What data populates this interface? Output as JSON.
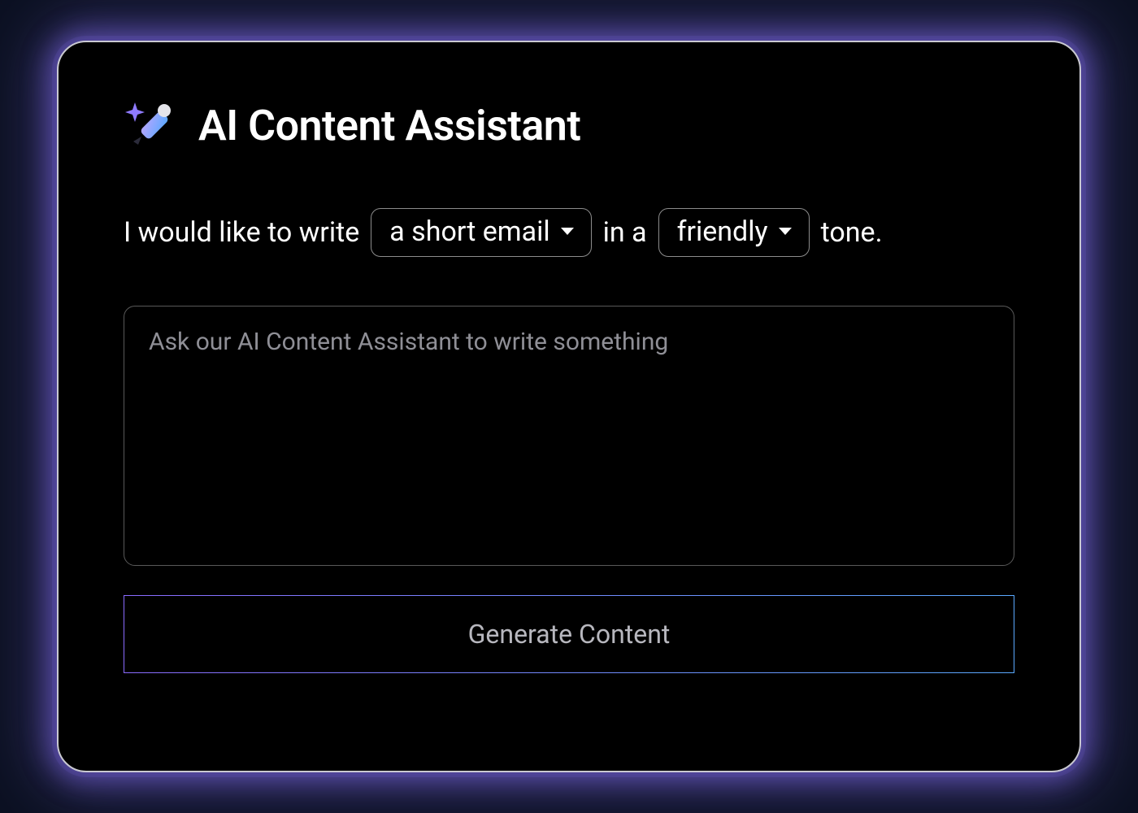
{
  "header": {
    "title": "AI Content Assistant",
    "icon": "magic-pencil-icon"
  },
  "sentence": {
    "prefix": "I would like to write",
    "type_select": {
      "value": "a short email"
    },
    "mid": "in a",
    "tone_select": {
      "value": "friendly"
    },
    "suffix": "tone."
  },
  "prompt": {
    "value": "",
    "placeholder": "Ask our AI Content Assistant to write something"
  },
  "actions": {
    "generate_label": "Generate Content"
  },
  "colors": {
    "bg": "#0c1122",
    "card_bg": "#000000",
    "glow": "#7a64dc",
    "text": "#ffffff",
    "muted": "#8f8f96",
    "accent_start": "#8a6bff",
    "accent_end": "#5aa9ff"
  }
}
